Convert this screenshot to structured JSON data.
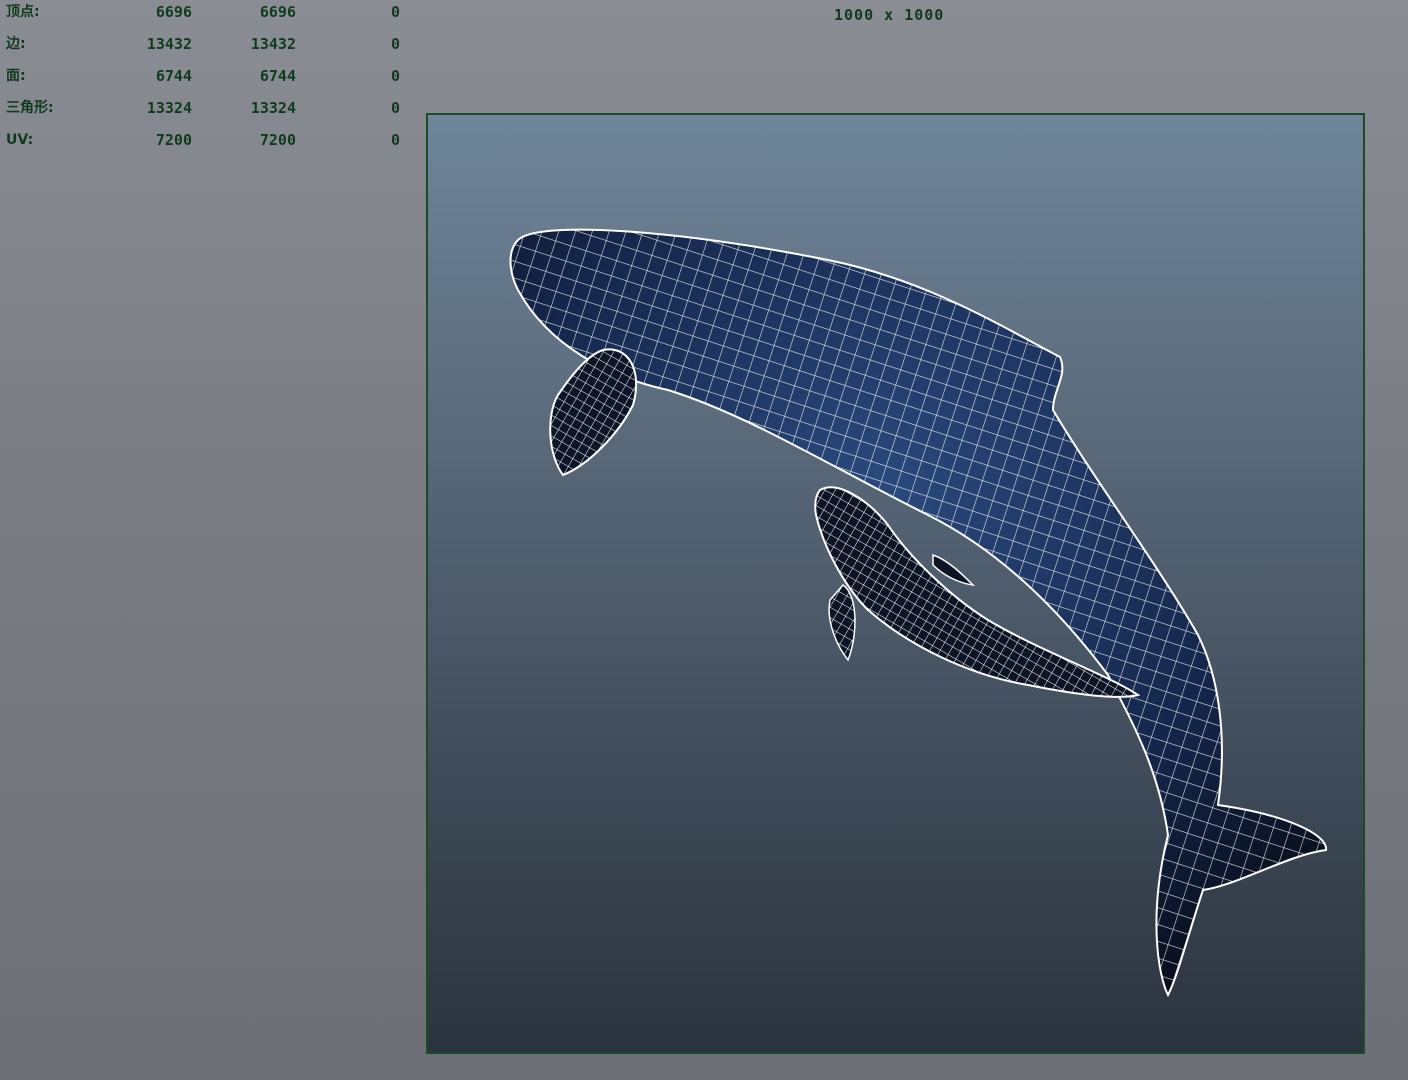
{
  "hud": {
    "rows": [
      {
        "label": "顶点:",
        "v1": "6696",
        "v2": "6696",
        "v3": "0"
      },
      {
        "label": "边:",
        "v1": "13432",
        "v2": "13432",
        "v3": "0"
      },
      {
        "label": "面:",
        "v1": "6744",
        "v2": "6744",
        "v3": "0"
      },
      {
        "label": "三角形:",
        "v1": "13324",
        "v2": "13324",
        "v3": "0"
      },
      {
        "label": "UV:",
        "v1": "7200",
        "v2": "7200",
        "v3": "0"
      }
    ]
  },
  "resolution_gate": "1000 x 1000",
  "viewport": {
    "subject_icon": "whale-wireframe-icon",
    "colors": {
      "hud_text": "#0f3a1d",
      "gate_border": "#1b4a28",
      "wire": "#ffffff",
      "body": "#16284a"
    }
  }
}
